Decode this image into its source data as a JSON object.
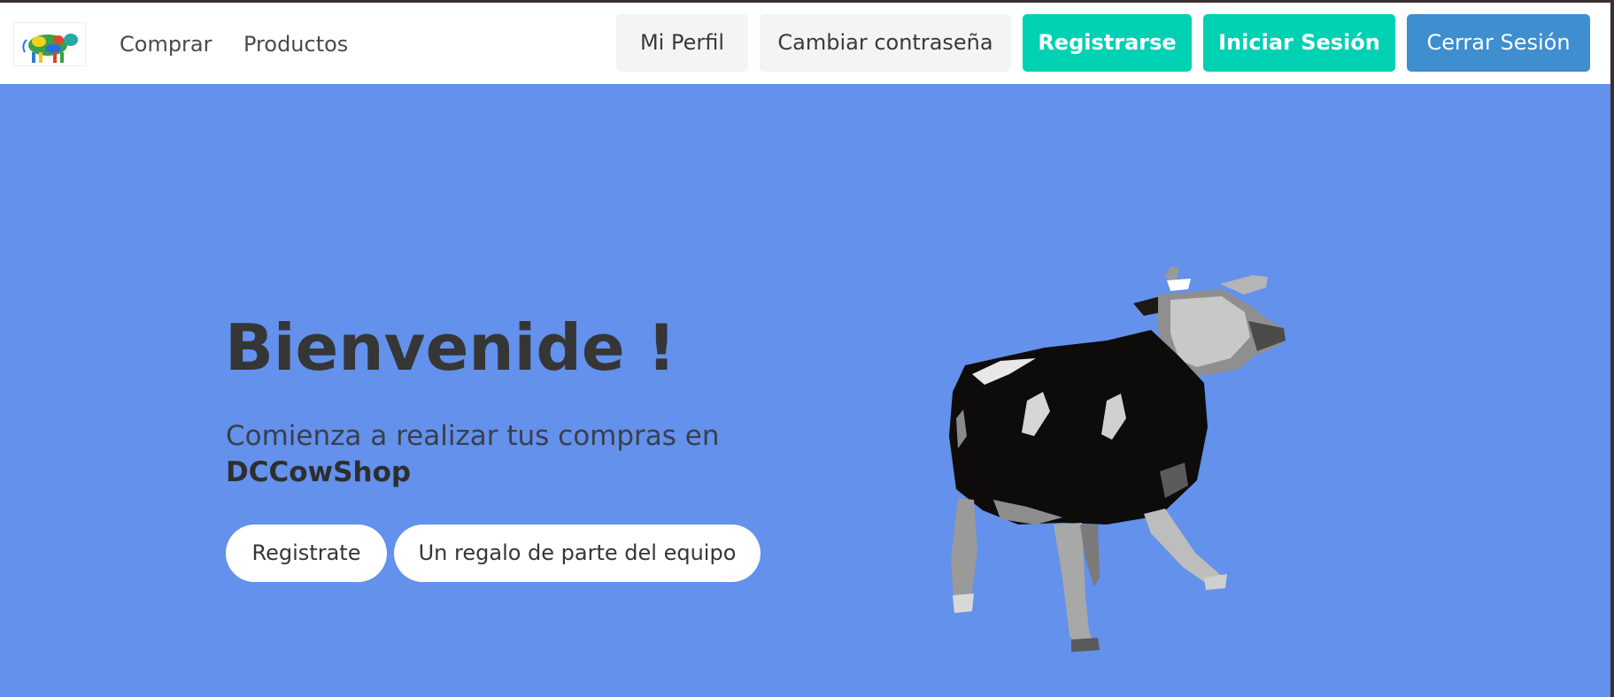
{
  "nav": {
    "links": [
      "Comprar",
      "Productos"
    ],
    "profile": "Mi Perfil",
    "change_password": "Cambiar contraseña",
    "register": "Registrarse",
    "login": "Iniciar Sesión",
    "logout": "Cerrar Sesión"
  },
  "hero": {
    "title": "Bienvenide !",
    "subtitle_text": "Comienza a realizar tus compras en",
    "shop_name": "DCCowShop",
    "buttons": [
      "Registrate",
      "Un regalo de parte del equipo"
    ]
  },
  "images": {
    "logo": "colorful-cow-logo",
    "hero": "dancing-cow"
  },
  "colors": {
    "hero_bg": "#6391eb",
    "primary": "#00d1b2",
    "info": "#3e8ed0",
    "light": "#f4f4f4"
  }
}
